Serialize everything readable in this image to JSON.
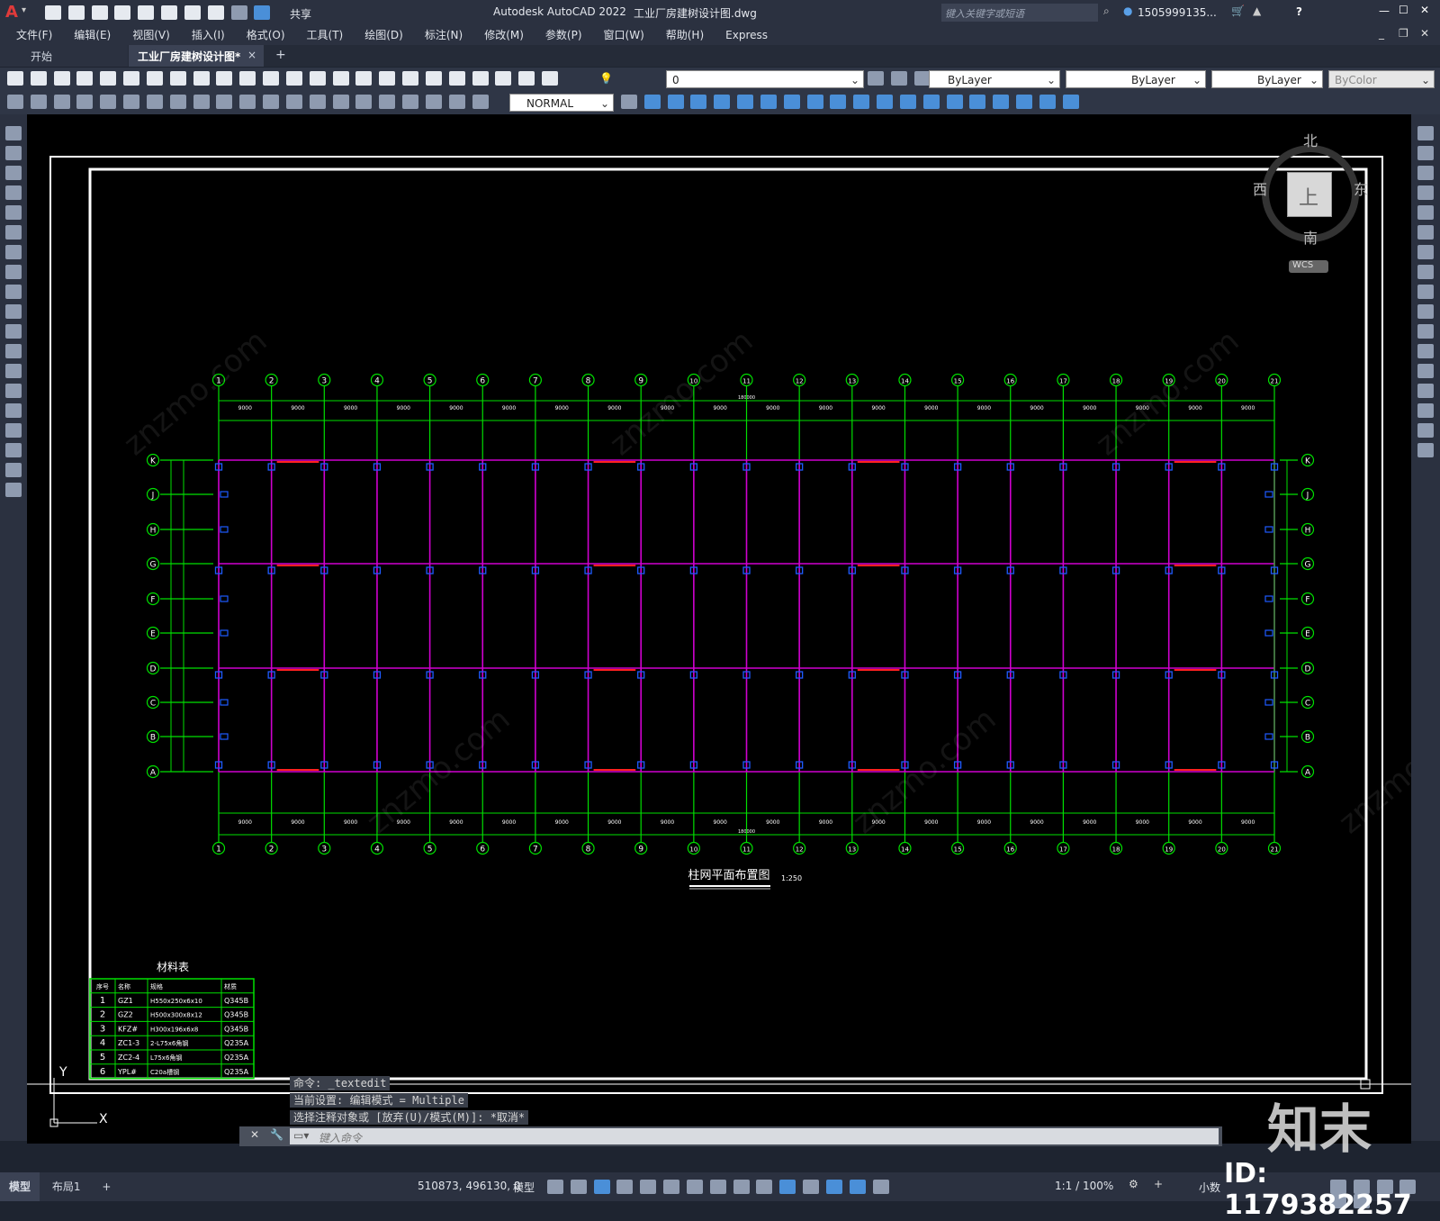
{
  "app": {
    "title": "Autodesk AutoCAD 2022",
    "doc_title": "工业厂房建树设计图.dwg",
    "share_label": "共享",
    "search_placeholder": "键入关键字或短语",
    "user": "1505999135...",
    "help": "?"
  },
  "menu": [
    "文件(F)",
    "编辑(E)",
    "视图(V)",
    "插入(I)",
    "格式(O)",
    "工具(T)",
    "绘图(D)",
    "标注(N)",
    "修改(M)",
    "参数(P)",
    "窗口(W)",
    "帮助(H)",
    "Express"
  ],
  "tabs": {
    "start": "开始",
    "active": "工业厂房建树设计图*",
    "close": "×",
    "add": "+"
  },
  "toolbar": {
    "layer_value": "0",
    "color_value": "ByLayer",
    "linetype_value": "ByLayer",
    "lineweight_value": "ByLayer",
    "plotstyle_value": "ByColor",
    "textstyle_value": "NORMAL"
  },
  "viewcube": {
    "north": "北",
    "south": "南",
    "west": "西",
    "east": "东",
    "top": "上",
    "wcs": "WCS"
  },
  "drawing": {
    "col_labels": [
      "1",
      "2",
      "3",
      "4",
      "5",
      "6",
      "7",
      "8",
      "9",
      "10",
      "11",
      "12",
      "13",
      "14",
      "15",
      "16",
      "17",
      "18",
      "19",
      "20",
      "21"
    ],
    "row_labels": [
      "K",
      "J",
      "H",
      "G",
      "F",
      "E",
      "D",
      "C",
      "B",
      "A"
    ],
    "span_label": "9000",
    "total_label": "180000",
    "title": "柱网平面布置图",
    "scale": "1:250"
  },
  "material_table": {
    "title": "材料表",
    "headers": [
      "序号",
      "名称",
      "规格",
      "材质"
    ],
    "rows": [
      [
        "1",
        "GZ1",
        "H550x250x6x10",
        "Q345B"
      ],
      [
        "2",
        "GZ2",
        "H500x300x8x12",
        "Q345B"
      ],
      [
        "3",
        "KFZ#",
        "H300x196x6x8",
        "Q345B"
      ],
      [
        "4",
        "ZC1-3",
        "2-L75x6角钢",
        "Q235A"
      ],
      [
        "5",
        "ZC2-4",
        "L75x6角钢",
        "Q235A"
      ],
      [
        "6",
        "YPL#",
        "C20a槽钢",
        "Q235A"
      ]
    ]
  },
  "ucs": {
    "x": "X",
    "y": "Y"
  },
  "command": {
    "history": [
      "命令: _textedit",
      "当前设置: 编辑模式 = Multiple",
      "选择注释对象或 [放弃(U)/模式(M)]: *取消*"
    ],
    "placeholder": "键入命令"
  },
  "layout_tabs": [
    "模型",
    "布局1",
    "+"
  ],
  "status": {
    "coords": "510873, 496130, 0",
    "space": "模型",
    "scale": "1:1 / 100%",
    "units": "小数"
  },
  "watermark": {
    "id": "ID: 1179382257",
    "logo": "知末",
    "site": "znzmo.com"
  },
  "colors": {
    "grid_green": "#00e000",
    "beam_magenta": "#d000d0",
    "column_blue": "#1e5bff",
    "highlight_red": "#ff2020",
    "canvas": "#000000"
  }
}
